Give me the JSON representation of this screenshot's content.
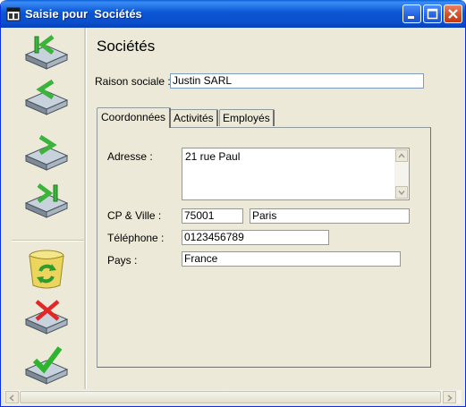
{
  "window": {
    "title": "Saisie pour  Sociétés",
    "icon": "app-window-icon",
    "controls": [
      "minimize-icon",
      "maximize-icon",
      "close-icon"
    ]
  },
  "toolbar": {
    "buttons": [
      {
        "name": "first-record",
        "icon": "first-record-icon"
      },
      {
        "name": "previous-record",
        "icon": "previous-record-icon"
      },
      {
        "name": "next-record",
        "icon": "next-record-icon"
      },
      {
        "name": "last-record",
        "icon": "last-record-icon"
      },
      {
        "name": "recycle-bin",
        "icon": "recycle-bin-icon"
      },
      {
        "name": "delete-record",
        "icon": "delete-icon"
      },
      {
        "name": "validate-record",
        "icon": "checkmark-icon"
      }
    ]
  },
  "form": {
    "heading": "Sociétés",
    "raison_sociale_label": "Raison sociale :",
    "raison_sociale_value": "Justin SARL"
  },
  "tabs": [
    {
      "label": "Coordonnées",
      "active": true
    },
    {
      "label": "Activités",
      "active": false
    },
    {
      "label": "Employés",
      "active": false
    }
  ],
  "coordonnees": {
    "adresse_label": "Adresse :",
    "adresse_value": "21 rue Paul",
    "cp_ville_label": "CP & Ville :",
    "cp_value": "75001",
    "ville_value": "Paris",
    "telephone_label": "Téléphone :",
    "telephone_value": "0123456789",
    "pays_label": "Pays :",
    "pays_value": "France"
  },
  "colors": {
    "titlebar": "#0a56d4",
    "window_bg": "#ece9d8",
    "field_border": "#7f9db9"
  }
}
